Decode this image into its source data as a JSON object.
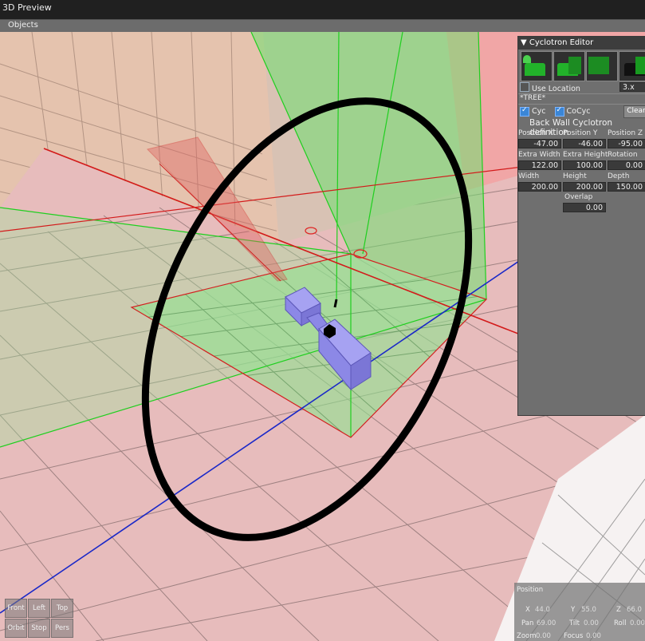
{
  "window": {
    "title": "3D Preview"
  },
  "menu": {
    "objects": "Objects"
  },
  "editor": {
    "title": "▼ Cyclotron Editor",
    "use_location_label": "Use Location",
    "use_location_checked": false,
    "scale_value": "3.x",
    "tree_label": "*TREE*",
    "cyc_label": "Cyc",
    "cyc_checked": true,
    "cocyc_label": "CoCyc",
    "cocyc_checked": true,
    "clear_label": "Clear",
    "section_title": "Back Wall Cyclotron definition",
    "fields": {
      "pos_x_label": "Position X",
      "pos_x": "-47.00",
      "pos_y_label": "Position Y",
      "pos_y": "-46.00",
      "pos_z_label": "Position Z",
      "pos_z": "-95.00",
      "extra_width_label": "Extra Width",
      "extra_width": "122.00",
      "extra_height_label": "Extra Height",
      "extra_height": "100.00",
      "rotation_label": "Rotation",
      "rotation": "0.00",
      "width_label": "Width",
      "width": "200.00",
      "height_label": "Height",
      "height": "200.00",
      "depth_label": "Depth",
      "depth": "150.00",
      "overlap_label": "Overlap",
      "overlap": "0.00"
    }
  },
  "view_buttons": {
    "front": "Front",
    "left": "Left",
    "top": "Top",
    "orbit": "Orbit",
    "stop": "Stop",
    "pers": "Pers"
  },
  "position_panel": {
    "title": "Position",
    "x_label": "X",
    "x": "44.0",
    "y_label": "Y",
    "y": "55.0",
    "z_label": "Z",
    "z": "66.0",
    "pan_label": "Pan",
    "pan": "69.00",
    "tilt_label": "Tilt",
    "tilt": "0.00",
    "roll_label": "Roll",
    "roll": "0.00",
    "zoom_label": "Zoom",
    "zoom": "0.00",
    "focus_label": "Focus",
    "focus": "0.00"
  },
  "colors": {
    "floor": "#e7bcbc",
    "wall_left": "#e5c3ae",
    "wall_right": "#f1a6a6",
    "green_volume": "#70e070",
    "axis_red": "#d31a1a",
    "axis_blue": "#1a28c8",
    "fixture": "#8c88e6"
  }
}
